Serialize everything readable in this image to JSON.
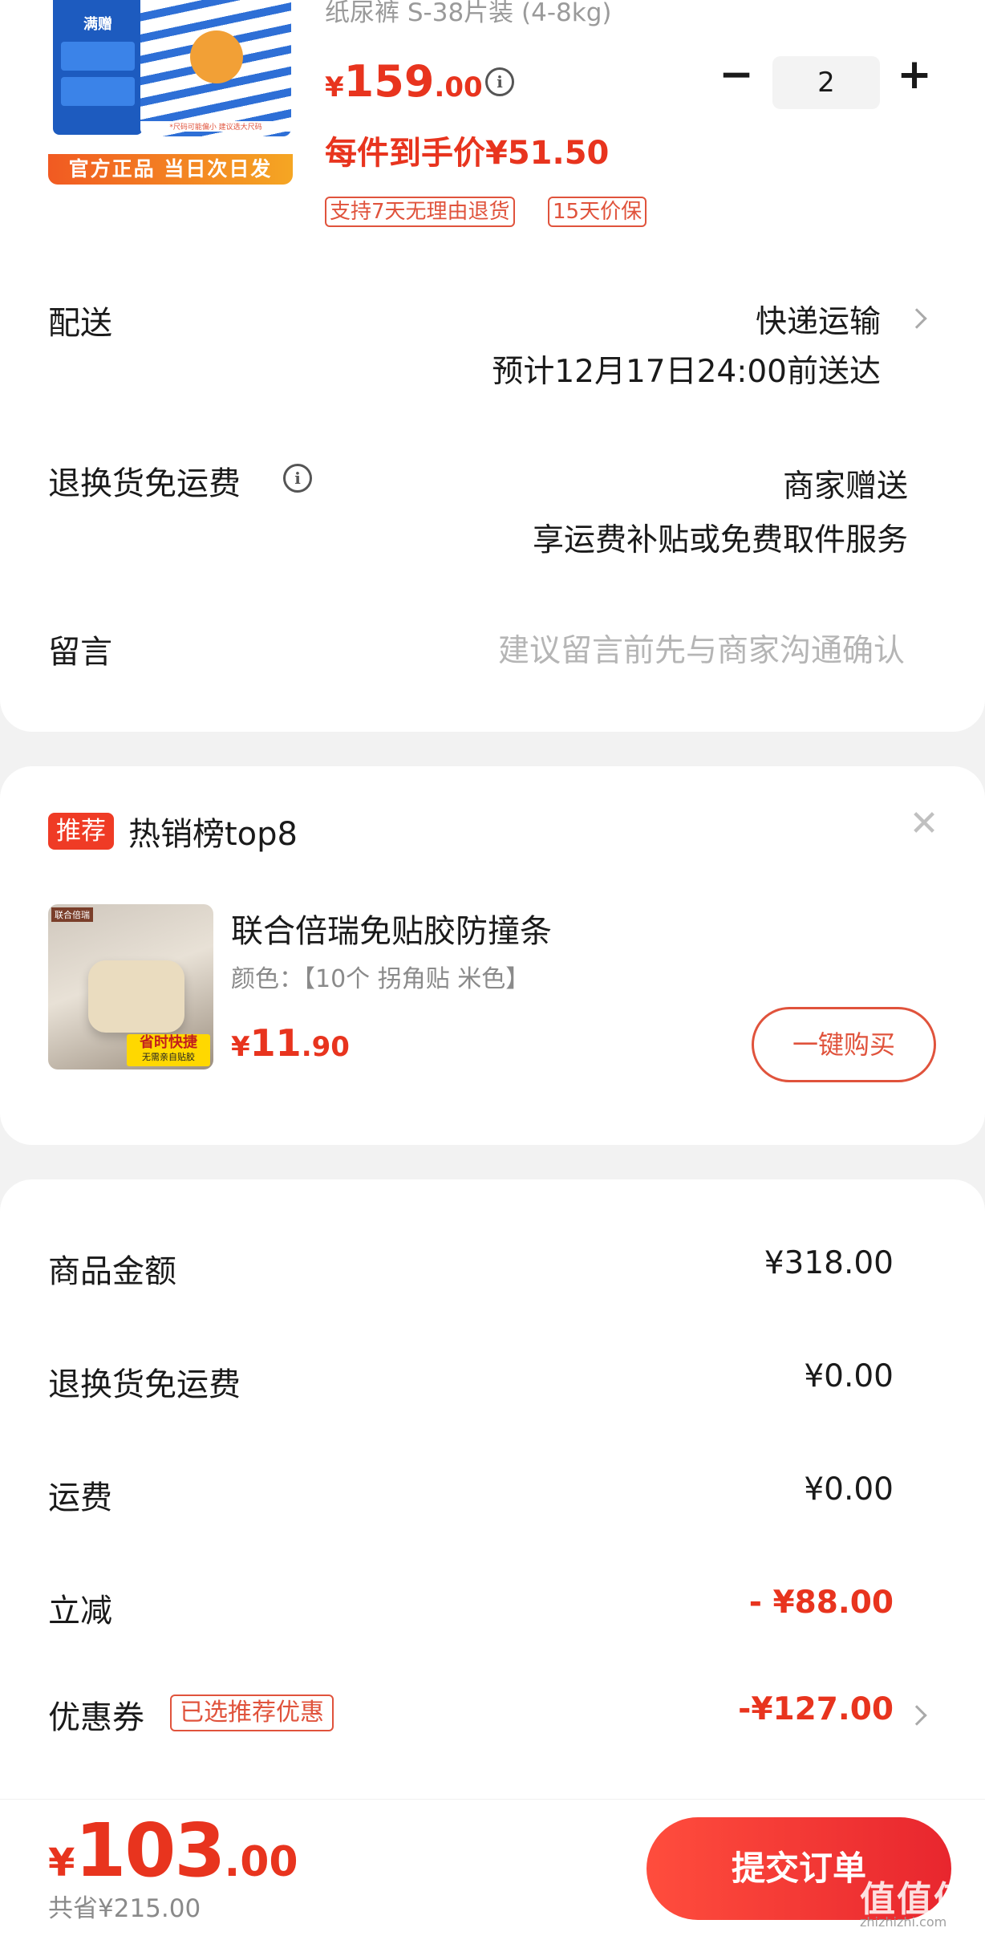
{
  "product": {
    "title": "纸尿裤 S-38片装 (4-8kg)",
    "image_badge": "满赠",
    "image_note": "*尺码可能偏小 建议选大尺码",
    "image_banner": "官方正品 当日次日发",
    "price_symbol": "¥",
    "price_int": "159",
    "price_dec": ".00",
    "price_info_icon": "info-icon",
    "quantity": "2",
    "minus_label": "−",
    "plus_label": "+",
    "final_price": "每件到手价¥51.50",
    "tags": [
      "支持7天无理由退货",
      "15天价保"
    ]
  },
  "delivery": {
    "label": "配送",
    "method": "快递运输",
    "eta": "预计12月17日24:00前送达"
  },
  "return_shipping": {
    "label": "退换货免运费",
    "value": "商家赠送",
    "desc": "享运费补贴或免费取件服务"
  },
  "message": {
    "label": "留言",
    "placeholder": "建议留言前先与商家沟通确认"
  },
  "recommend": {
    "badge": "推荐",
    "title": "热销榜top8",
    "close_icon": "close-icon",
    "item_name": "联合倍瑞免贴胶防撞条",
    "item_spec": "颜色：【10个 拐角贴 米色】",
    "image_sticker": "联合倍瑞",
    "image_tag_main": "省时快捷",
    "image_tag_sub": "无需亲自贴胶",
    "price_symbol": "¥",
    "price_int": "11",
    "price_dec": ".90",
    "buy_label": "一键购买"
  },
  "summary": {
    "rows": [
      {
        "label": "商品金额",
        "value": "¥318.00"
      },
      {
        "label": "退换货免运费",
        "value": "¥0.00"
      },
      {
        "label": "运费",
        "value": "¥0.00"
      },
      {
        "label": "立减",
        "value": "- ¥88.00"
      },
      {
        "label": "优惠券",
        "value": "-¥127.00",
        "tag": "已选推荐优惠"
      }
    ]
  },
  "footer": {
    "price_symbol": "¥",
    "total_int": "103",
    "total_dec": ".00",
    "saved": "共省¥215.00",
    "submit_label": "提交订单",
    "watermark": "值值值",
    "watermark_sub": "zhizhizhi.com"
  },
  "colors": {
    "accent": "#e8341e",
    "tag_border": "#e0533c",
    "background": "#f2f2f2"
  }
}
